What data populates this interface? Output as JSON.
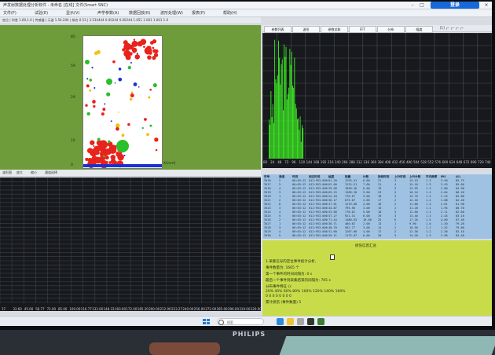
{
  "window": {
    "title": "声发射数据处理分析软件 - 未命名 [在线] 文件(Smart SNC)",
    "login_label": "登录",
    "min": "–",
    "max": "□",
    "close": "×"
  },
  "menu": [
    "文件(F)",
    "试验(E)",
    "显示(V)",
    "声学参数(A)",
    "数据回放(R)",
    "波形处理(W)",
    "报表(P)",
    "帮助(H)"
  ],
  "left_toolbar": {
    "text": "定位 | 时差 1.60,1.0 | 传感器 | 示波 1.54.200 | 拟合 0.53 | 3.534444 0.00244 0.00244 1.651 1.001 1.001 1.0"
  },
  "right_tabs": [
    "参数列表",
    "波形",
    "参数关联",
    "FFT",
    "分布",
    "幅度"
  ],
  "right_toolbar_extra": "[1] ┌─ ┌─ ┌─ ┌─",
  "scatter": {
    "y_ticks": [
      "85",
      "59",
      "29",
      "10",
      "0"
    ],
    "x_label": "X[mm]"
  },
  "histogram": {
    "x_ticks": [
      "00",
      "24",
      "48",
      "72",
      "96",
      "120",
      "144",
      "168",
      "192",
      "216",
      "240",
      "264",
      "288",
      "312",
      "336",
      "360",
      "384",
      "408",
      "432",
      "456",
      "480",
      "504",
      "528",
      "552",
      "576",
      "600",
      "624",
      "648",
      "672",
      "696",
      "720",
      "744"
    ]
  },
  "bottom_left_toolbar": [
    "波形图",
    "放大",
    "缩小",
    "通道选择"
  ],
  "dark_axis": [
    "17",
    "33.60",
    "45.00",
    "56.77",
    "72.00",
    "85.00",
    "100.00",
    "116.77",
    "133.00",
    "148.33",
    "160.00",
    "172.00",
    "185.20",
    "200.00",
    "212.00",
    "223.27",
    "240.00",
    "256.00",
    "272.00",
    "285.00",
    "296.00",
    "310.00",
    "320.00"
  ],
  "table": {
    "headers": [
      "序号",
      "通道",
      "时间",
      "到达时间",
      "幅度",
      "能量",
      "计数",
      "持续时间",
      "上升时间",
      "上升计数",
      "平均频率",
      "RMS",
      "ASL"
    ],
    "rows": [
      [
        "3516",
        "2",
        "00:03:12",
        "012:953.000",
        "61.20",
        "1293.41",
        "6.00",
        "21",
        "3",
        "14.43",
        "1.3",
        "3.40",
        "85.75"
      ],
      [
        "3517",
        "5",
        "00:03:12",
        "012:953.000",
        "62.00",
        "1215.51",
        "7.00",
        "21",
        "4",
        "15.10",
        "1.3",
        "3.43",
        "85.60"
      ],
      [
        "3518",
        "4",
        "00:03:12",
        "012:953.000",
        "59.00",
        "1058.26",
        "6.00",
        "19",
        "3",
        "13.95",
        "1.3",
        "2.80",
        "84.90"
      ],
      [
        "3519",
        "3",
        "00:03:12",
        "012:953.000",
        "65.25",
        "1286.28",
        "9.00",
        "23",
        "5",
        "16.24",
        "1.4",
        "4.04",
        "86.20"
      ],
      [
        "3520",
        "1",
        "00:03:12",
        "012:953.000",
        "54.18",
        "776.67",
        "5.00",
        "18",
        "3",
        "13.70",
        "1.2",
        "2.23",
        "83.80"
      ],
      [
        "3521",
        "2",
        "00:03:12",
        "012:953.000",
        "50.17",
        "675.07",
        "4.00",
        "17",
        "2",
        "12.10",
        "1.2",
        "1.88",
        "82.40"
      ],
      [
        "3522",
        "6",
        "00:03:12",
        "012:953.000",
        "47.01",
        "1219.00",
        "4.00",
        "16",
        "2",
        "11.80",
        "1.3",
        "2.61",
        "81.90"
      ],
      [
        "3523",
        "3",
        "00:03:12",
        "012:953.000",
        "44.87",
        "795.56",
        "3.00",
        "15",
        "2",
        "11.20",
        "1.1",
        "1.95",
        "80.70"
      ],
      [
        "3524",
        "4",
        "00:03:12",
        "012:953.000",
        "53.00",
        "778.01",
        "5.00",
        "18",
        "3",
        "12.80",
        "1.2",
        "2.11",
        "82.60"
      ],
      [
        "3525",
        "5",
        "00:03:12",
        "012:953.000",
        "57.27",
        "921.31",
        "6.00",
        "19",
        "3",
        "13.40",
        "1.3",
        "2.44",
        "83.10"
      ],
      [
        "3526",
        "2",
        "00:03:12",
        "012:953.000",
        "71.44",
        "1480.63",
        "10.00",
        "25",
        "6",
        "17.20",
        "1.5",
        "4.60",
        "87.40"
      ],
      [
        "3527",
        "1",
        "00:03:12",
        "012:953.000",
        "38.71",
        "460.62",
        "2.00",
        "13",
        "1",
        "9.90",
        "1.0",
        "1.30",
        "79.20"
      ],
      [
        "3528",
        "3",
        "00:03:12",
        "012:953.000",
        "40.70",
        "562.77",
        "3.00",
        "14",
        "2",
        "10.50",
        "1.1",
        "1.52",
        "79.80"
      ],
      [
        "3529",
        "4",
        "00:03:12",
        "012:953.000",
        "51.60",
        "1267.00",
        "4.00",
        "17",
        "2",
        "12.30",
        "1.2",
        "2.30",
        "82.10"
      ],
      [
        "3530",
        "5",
        "00:03:12",
        "012:953.000",
        "59.11",
        "1175.07",
        "6.00",
        "20",
        "3",
        "14.20",
        "1.3",
        "2.96",
        "84.40"
      ]
    ]
  },
  "yellow": {
    "title": "损伤信息汇总",
    "lines": [
      "1.采集信号的定位事件统计分析,",
      "事件数量为: 1665 个",
      "第一个事件的时间间隔为: 0 s",
      "最后一个事件到采集结束的间隔为: 705 s",
      "分布事件特征 ():",
      "  20% 40% 60% 80% 100% 120% 140% 160%",
      "  0    0    0    0    0    0    0    0",
      "累计损伤 (事件数量) 5"
    ]
  },
  "taskbar": {
    "search_placeholder": "搜索"
  }
}
